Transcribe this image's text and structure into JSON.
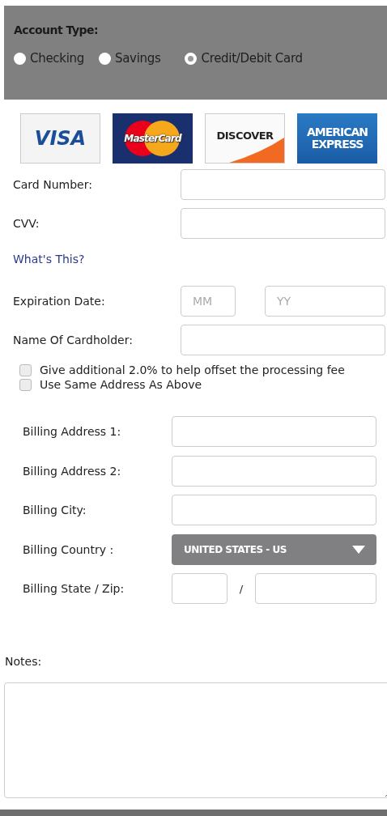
{
  "account_type": {
    "label": "Account Type:",
    "options": [
      {
        "label": "Checking",
        "selected": false
      },
      {
        "label": "Savings",
        "selected": false
      },
      {
        "label": "Credit/Debit Card",
        "selected": true
      }
    ]
  },
  "cards": [
    {
      "kind": "visa",
      "text": "VISA"
    },
    {
      "kind": "mastercard",
      "text": "MasterCard"
    },
    {
      "kind": "discover",
      "text": "DISCOVER"
    },
    {
      "kind": "amex",
      "text": "AMERICAN EXPRESS"
    }
  ],
  "card_fields": [
    {
      "kind": "text",
      "label": "Card Number:"
    },
    {
      "kind": "text",
      "label": "CVV:"
    },
    {
      "kind": "link",
      "label": "What's This?"
    },
    {
      "kind": "pair",
      "label": "Expiration Date:",
      "placeholders": [
        "MM",
        "YY"
      ]
    },
    {
      "kind": "text",
      "label": "Name Of Cardholder:"
    }
  ],
  "checkboxes": [
    {
      "label": "Give additional 2.0% to help offset the processing fee",
      "checked": false
    },
    {
      "label": "Use Same Address As Above",
      "checked": false
    }
  ],
  "billing_fields": [
    {
      "kind": "text",
      "label": "Billing Address 1:"
    },
    {
      "kind": "text",
      "label": "Billing Address 2:"
    },
    {
      "kind": "text",
      "label": "Billing City:"
    },
    {
      "kind": "select",
      "label": "Billing Country :",
      "value": "UNITED STATES - US"
    },
    {
      "kind": "pair",
      "label": "Billing State / Zip:",
      "separator": "/"
    }
  ],
  "notes": {
    "label": "Notes:"
  }
}
